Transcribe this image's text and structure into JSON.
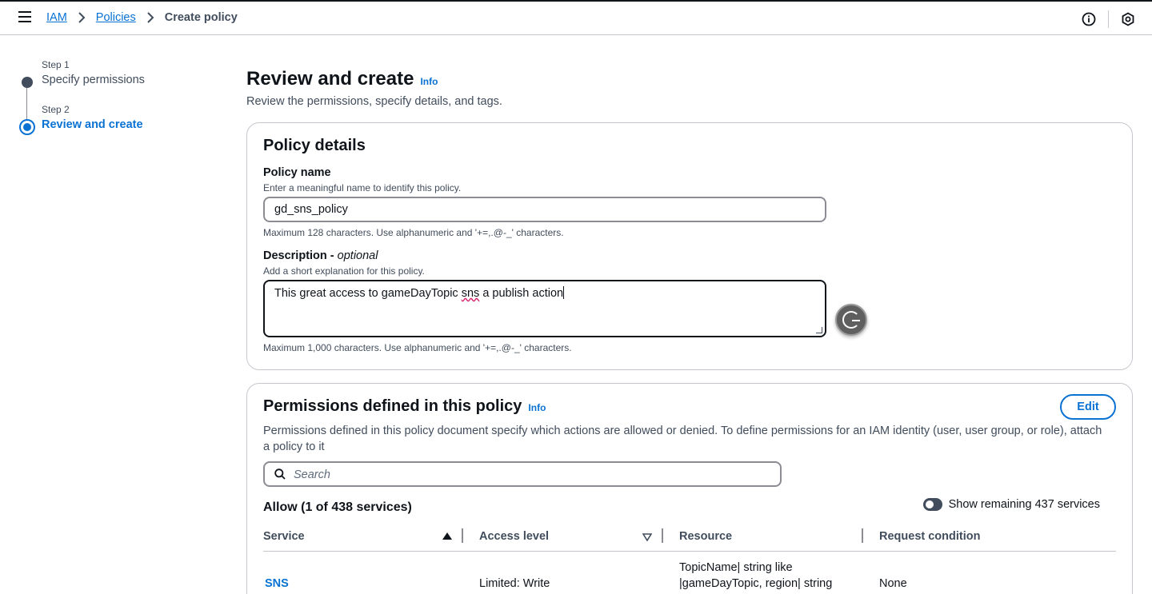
{
  "breadcrumb": {
    "items": [
      "IAM",
      "Policies"
    ],
    "current": "Create policy"
  },
  "steps": [
    {
      "number": "Step 1",
      "title": "Specify permissions"
    },
    {
      "number": "Step 2",
      "title": "Review and create"
    }
  ],
  "page": {
    "title": "Review and create",
    "info": "Info",
    "description": "Review the permissions, specify details, and tags."
  },
  "policy_details": {
    "title": "Policy details",
    "name_label": "Policy name",
    "name_hint": "Enter a meaningful name to identify this policy.",
    "name_value": "gd_sns_policy",
    "name_constraint": "Maximum 128 characters. Use alphanumeric and '+=,.@-_' characters.",
    "desc_label": "Description - ",
    "desc_optional": "optional",
    "desc_hint": "Add a short explanation for this policy.",
    "desc_value_part1": "This great access to gameDayTopic ",
    "desc_value_misspelled": "sns",
    "desc_value_part2": " a publish action",
    "desc_constraint": "Maximum 1,000 characters. Use alphanumeric and '+=,.@-_' characters."
  },
  "permissions": {
    "title": "Permissions defined in this policy",
    "info": "Info",
    "edit_label": "Edit",
    "description": "Permissions defined in this policy document specify which actions are allowed or denied. To define permissions for an IAM identity (user, user group, or role), attach a policy to it",
    "search_placeholder": "Search",
    "allow_title": "Allow (1 of 438 services)",
    "toggle_label": "Show remaining 437 services",
    "columns": [
      "Service",
      "Access level",
      "Resource",
      "Request condition"
    ],
    "rows": [
      {
        "service": "SNS",
        "access_level": "Limited: Write",
        "resource_line1": "TopicName| string like",
        "resource_line2": "|gameDayTopic, region| string",
        "request_condition": "None"
      }
    ]
  }
}
